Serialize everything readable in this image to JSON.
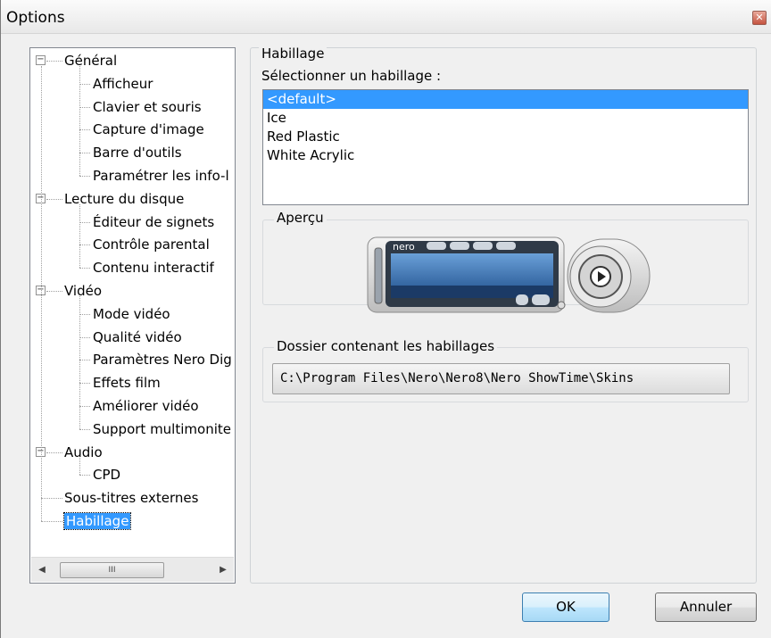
{
  "window": {
    "title": "Options",
    "close_glyph": "✕"
  },
  "tree": {
    "nodes": [
      {
        "label": "Général",
        "level": 0,
        "expanded": true
      },
      {
        "label": "Afficheur",
        "level": 1
      },
      {
        "label": "Clavier et souris",
        "level": 1
      },
      {
        "label": "Capture d'image",
        "level": 1
      },
      {
        "label": "Barre d'outils",
        "level": 1
      },
      {
        "label": "Paramétrer les info-l",
        "level": 1
      },
      {
        "label": "Lecture du disque",
        "level": 0,
        "expanded": true
      },
      {
        "label": "Éditeur de signets",
        "level": 1
      },
      {
        "label": "Contrôle parental",
        "level": 1
      },
      {
        "label": "Contenu interactif",
        "level": 1
      },
      {
        "label": "Vidéo",
        "level": 0,
        "expanded": true
      },
      {
        "label": "Mode vidéo",
        "level": 1
      },
      {
        "label": "Qualité vidéo",
        "level": 1
      },
      {
        "label": "Paramètres Nero Dig",
        "level": 1
      },
      {
        "label": "Effets film",
        "level": 1
      },
      {
        "label": "Améliorer vidéo",
        "level": 1
      },
      {
        "label": "Support multimonite",
        "level": 1
      },
      {
        "label": "Audio",
        "level": 0,
        "expanded": true
      },
      {
        "label": "CPD",
        "level": 1
      },
      {
        "label": "Sous-titres externes",
        "level": 0
      },
      {
        "label": "Habillage",
        "level": 0,
        "selected": true
      }
    ],
    "scroll_left": "◀",
    "scroll_right": "▶",
    "scroll_thumb_grip": "III"
  },
  "skin_panel": {
    "group_title": "Habillage",
    "select_label": "Sélectionner un habillage :",
    "skins": [
      "<default>",
      "Ice",
      "Red Plastic",
      "White Acrylic"
    ],
    "selected_index": 0,
    "preview_title": "Aperçu",
    "preview_brand": "nero",
    "folder_title": "Dossier contenant les habillages",
    "folder_path": "C:\\Program Files\\Nero\\Nero8\\Nero ShowTime\\Skins"
  },
  "buttons": {
    "ok": "OK",
    "cancel": "Annuler"
  },
  "colors": {
    "selection": "#3399ff",
    "window_bg": "#f0f0f0"
  }
}
